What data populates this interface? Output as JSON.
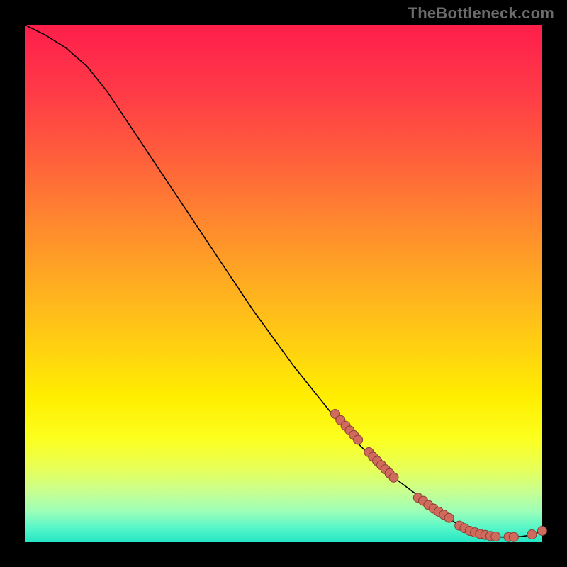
{
  "watermark": "TheBottleneck.com",
  "colors": {
    "dot_fill": "#cf6a5d",
    "dot_stroke": "#8a3e36",
    "curve_stroke": "#000000"
  },
  "chart_data": {
    "type": "line",
    "title": "",
    "xlabel": "",
    "ylabel": "",
    "xlim": [
      0,
      100
    ],
    "ylim": [
      0,
      100
    ],
    "series": [
      {
        "name": "curve",
        "x": [
          0,
          4,
          8,
          12,
          16,
          20,
          24,
          28,
          32,
          36,
          40,
          44,
          48,
          52,
          56,
          60,
          64,
          68,
          72,
          76,
          80,
          82,
          84,
          86,
          88,
          90,
          92,
          94,
          96,
          98,
          100
        ],
        "y": [
          100,
          98,
          95.5,
          92,
          87,
          81,
          75,
          69,
          63,
          57,
          51,
          45,
          39.5,
          34,
          29,
          24,
          19.5,
          15.5,
          12,
          9,
          6.2,
          4.6,
          3.2,
          2.2,
          1.6,
          1.2,
          1.0,
          1.0,
          1.1,
          1.4,
          2.2
        ]
      }
    ],
    "scatter_points": [
      {
        "x": 60.0,
        "y": 24.8
      },
      {
        "x": 61.0,
        "y": 23.6
      },
      {
        "x": 62.0,
        "y": 22.5
      },
      {
        "x": 62.8,
        "y": 21.6
      },
      {
        "x": 63.6,
        "y": 20.7
      },
      {
        "x": 64.4,
        "y": 19.8
      },
      {
        "x": 66.5,
        "y": 17.4
      },
      {
        "x": 67.3,
        "y": 16.5
      },
      {
        "x": 68.1,
        "y": 15.7
      },
      {
        "x": 68.9,
        "y": 14.9
      },
      {
        "x": 69.7,
        "y": 14.1
      },
      {
        "x": 70.5,
        "y": 13.3
      },
      {
        "x": 71.3,
        "y": 12.5
      },
      {
        "x": 76.0,
        "y": 8.6
      },
      {
        "x": 77.0,
        "y": 8.0
      },
      {
        "x": 78.0,
        "y": 7.2
      },
      {
        "x": 79.0,
        "y": 6.5
      },
      {
        "x": 80.0,
        "y": 5.9
      },
      {
        "x": 81.0,
        "y": 5.3
      },
      {
        "x": 82.0,
        "y": 4.7
      },
      {
        "x": 84.0,
        "y": 3.2
      },
      {
        "x": 85.0,
        "y": 2.7
      },
      {
        "x": 86.0,
        "y": 2.2
      },
      {
        "x": 87.0,
        "y": 1.9
      },
      {
        "x": 88.0,
        "y": 1.6
      },
      {
        "x": 89.0,
        "y": 1.4
      },
      {
        "x": 90.0,
        "y": 1.2
      },
      {
        "x": 91.0,
        "y": 1.1
      },
      {
        "x": 93.5,
        "y": 1.0
      },
      {
        "x": 94.5,
        "y": 1.0
      },
      {
        "x": 98.0,
        "y": 1.5
      },
      {
        "x": 100.0,
        "y": 2.2
      }
    ]
  }
}
